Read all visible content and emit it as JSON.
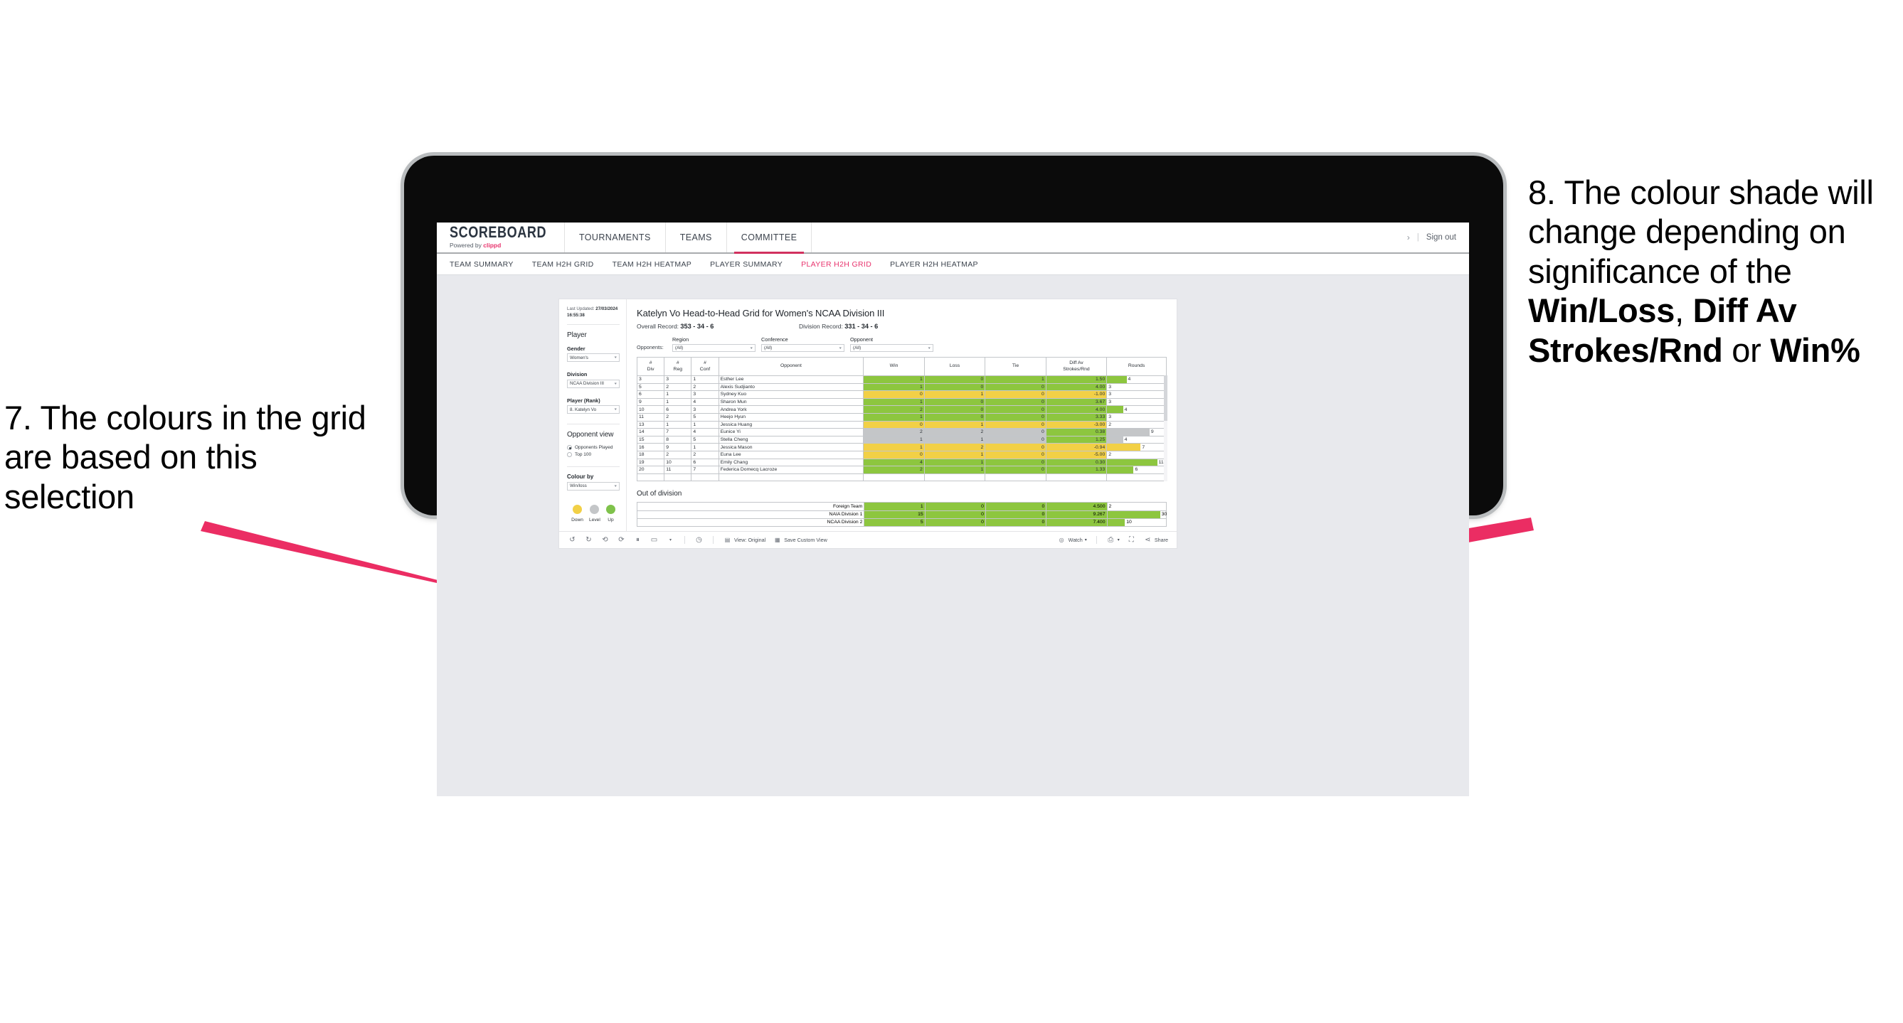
{
  "annotations": {
    "left": "7. The colours in the grid are based on this selection",
    "right_prefix": "8. The colour shade will change depending on significance of the ",
    "right_bold_1": "Win/Loss",
    "right_mid_1": ", ",
    "right_bold_2": "Diff Av Strokes/Rnd",
    "right_mid_2": " or ",
    "right_bold_3": "Win%",
    "arrow_color": "#EB2D63"
  },
  "app": {
    "brand": {
      "name": "SCOREBOARD",
      "powered_by": "Powered by ",
      "vendor": "clippd"
    },
    "nav": [
      {
        "label": "TOURNAMENTS",
        "active": false
      },
      {
        "label": "TEAMS",
        "active": false
      },
      {
        "label": "COMMITTEE",
        "active": true
      }
    ],
    "account": {
      "chevron": "›",
      "divider": "|",
      "sign_out": "Sign out"
    },
    "subnav": [
      {
        "label": "TEAM SUMMARY",
        "active": false
      },
      {
        "label": "TEAM H2H GRID",
        "active": false
      },
      {
        "label": "TEAM H2H HEATMAP",
        "active": false
      },
      {
        "label": "PLAYER SUMMARY",
        "active": false
      },
      {
        "label": "PLAYER H2H GRID",
        "active": true
      },
      {
        "label": "PLAYER H2H HEATMAP",
        "active": false
      }
    ]
  },
  "panel": {
    "last_updated_label": "Last Updated: ",
    "last_updated_value": "27/03/2024 16:55:38",
    "heading": "Player",
    "gender": {
      "label": "Gender",
      "value": "Women's"
    },
    "division": {
      "label": "Division",
      "value": "NCAA Division III"
    },
    "player_rank": {
      "label": "Player (Rank)",
      "value": "8. Katelyn Vo"
    },
    "opponent_view": {
      "heading": "Opponent view",
      "options": [
        {
          "label": "Opponents Played",
          "selected": true
        },
        {
          "label": "Top 100",
          "selected": false
        }
      ]
    },
    "colour_by": {
      "label": "Colour by",
      "value": "Win/loss"
    },
    "legend": [
      {
        "label": "Down",
        "color": "#F2D046"
      },
      {
        "label": "Level",
        "color": "#C4C6C8"
      },
      {
        "label": "Up",
        "color": "#7FC24B"
      }
    ]
  },
  "main": {
    "title": "Katelyn Vo Head-to-Head Grid for Women's NCAA Division III",
    "overall_record_label": "Overall Record: ",
    "overall_record_value": "353 - 34 - 6",
    "division_record_label": "Division Record: ",
    "division_record_value": "331 - 34 - 6",
    "opponents_label": "Opponents:",
    "filters": [
      {
        "label": "Region",
        "value": "(All)"
      },
      {
        "label": "Conference",
        "value": "(All)"
      },
      {
        "label": "Opponent",
        "value": "(All)"
      }
    ],
    "columns": [
      "# Div",
      "# Reg",
      "# Conf",
      "Opponent",
      "Win",
      "Loss",
      "Tie",
      "Diff Av Strokes/Rnd",
      "Rounds"
    ],
    "column_lines": [
      [
        "#",
        "Div"
      ],
      [
        "#",
        "Reg"
      ],
      [
        "#",
        "Conf"
      ],
      [
        "Opponent",
        ""
      ],
      [
        "Win",
        ""
      ],
      [
        "Loss",
        ""
      ],
      [
        "Tie",
        ""
      ],
      [
        "Diff Av",
        "Strokes/Rnd"
      ],
      [
        "Rounds",
        ""
      ]
    ],
    "rows": [
      {
        "div": "3",
        "reg": "3",
        "conf": "1",
        "opponent": "Esther Lee",
        "win": "1",
        "loss": "0",
        "tie": "1",
        "diff": "1.50",
        "rounds": "4",
        "fill": "#8DC63F",
        "bar_pct": 33
      },
      {
        "div": "5",
        "reg": "2",
        "conf": "2",
        "opponent": "Alexis Sudjianto",
        "win": "1",
        "loss": "0",
        "tie": "0",
        "diff": "4.00",
        "rounds": "3",
        "fill": "#8DC63F",
        "bar_pct": 0
      },
      {
        "div": "6",
        "reg": "1",
        "conf": "3",
        "opponent": "Sydney Kuo",
        "win": "0",
        "loss": "1",
        "tie": "0",
        "diff": "-1.00",
        "rounds": "3",
        "fill": "#F2D046",
        "bar_pct": 0
      },
      {
        "div": "9",
        "reg": "1",
        "conf": "4",
        "opponent": "Sharon Mun",
        "win": "1",
        "loss": "0",
        "tie": "0",
        "diff": "3.67",
        "rounds": "3",
        "fill": "#8DC63F",
        "bar_pct": 0
      },
      {
        "div": "10",
        "reg": "6",
        "conf": "3",
        "opponent": "Andrea York",
        "win": "2",
        "loss": "0",
        "tie": "0",
        "diff": "4.00",
        "rounds": "4",
        "fill": "#8DC63F",
        "bar_pct": 27
      },
      {
        "div": "11",
        "reg": "2",
        "conf": "5",
        "opponent": "Heejo Hyun",
        "win": "1",
        "loss": "0",
        "tie": "0",
        "diff": "3.33",
        "rounds": "3",
        "fill": "#8DC63F",
        "bar_pct": 0
      },
      {
        "div": "13",
        "reg": "1",
        "conf": "1",
        "opponent": "Jessica Huang",
        "win": "0",
        "loss": "1",
        "tie": "0",
        "diff": "-3.00",
        "rounds": "2",
        "fill": "#F2D046",
        "bar_pct": 0
      },
      {
        "div": "14",
        "reg": "7",
        "conf": "4",
        "opponent": "Eunice Yi",
        "win": "2",
        "loss": "2",
        "tie": "0",
        "diff": "0.38",
        "rounds": "9",
        "fill": "#C4C6C8",
        "bar_pct": 72,
        "diff_fill": "#8DC63F"
      },
      {
        "div": "15",
        "reg": "8",
        "conf": "5",
        "opponent": "Stella Cheng",
        "win": "1",
        "loss": "1",
        "tie": "0",
        "diff": "1.25",
        "rounds": "4",
        "fill": "#C4C6C8",
        "bar_pct": 27,
        "diff_fill": "#8DC63F"
      },
      {
        "div": "16",
        "reg": "9",
        "conf": "1",
        "opponent": "Jessica Mason",
        "win": "1",
        "loss": "2",
        "tie": "0",
        "diff": "-0.94",
        "rounds": "7",
        "fill": "#F2D046",
        "bar_pct": 57
      },
      {
        "div": "18",
        "reg": "2",
        "conf": "2",
        "opponent": "Euna Lee",
        "win": "0",
        "loss": "1",
        "tie": "0",
        "diff": "-5.00",
        "rounds": "2",
        "fill": "#F2D046",
        "bar_pct": 0
      },
      {
        "div": "19",
        "reg": "10",
        "conf": "6",
        "opponent": "Emily Chang",
        "win": "4",
        "loss": "1",
        "tie": "0",
        "diff": "0.30",
        "rounds": "11",
        "fill": "#8DC63F",
        "bar_pct": 85
      },
      {
        "div": "20",
        "reg": "11",
        "conf": "7",
        "opponent": "Federica Domecq Lacroze",
        "win": "2",
        "loss": "1",
        "tie": "0",
        "diff": "1.33",
        "rounds": "6",
        "fill": "#8DC63F",
        "bar_pct": 45
      }
    ],
    "out_of_division": {
      "title": "Out of division",
      "rows": [
        {
          "name": "Foreign Team",
          "win": "1",
          "loss": "0",
          "tie": "0",
          "diff": "4.500",
          "rounds": "2",
          "fill": "#8DC63F",
          "bar_pct": 0
        },
        {
          "name": "NAIA Division 1",
          "win": "15",
          "loss": "0",
          "tie": "0",
          "diff": "9.267",
          "rounds": "30",
          "fill": "#8DC63F",
          "bar_pct": 90
        },
        {
          "name": "NCAA Division 2",
          "win": "5",
          "loss": "0",
          "tie": "0",
          "diff": "7.400",
          "rounds": "10",
          "fill": "#8DC63F",
          "bar_pct": 30
        }
      ]
    }
  },
  "toolbar": {
    "icons": [
      "undo-icon",
      "redo-icon",
      "revert-icon",
      "refresh-icon",
      "pause-icon",
      "highlight-icon"
    ],
    "view_original": "View: Original",
    "save_custom_view": "Save Custom View",
    "watch": "Watch",
    "share": "Share"
  }
}
